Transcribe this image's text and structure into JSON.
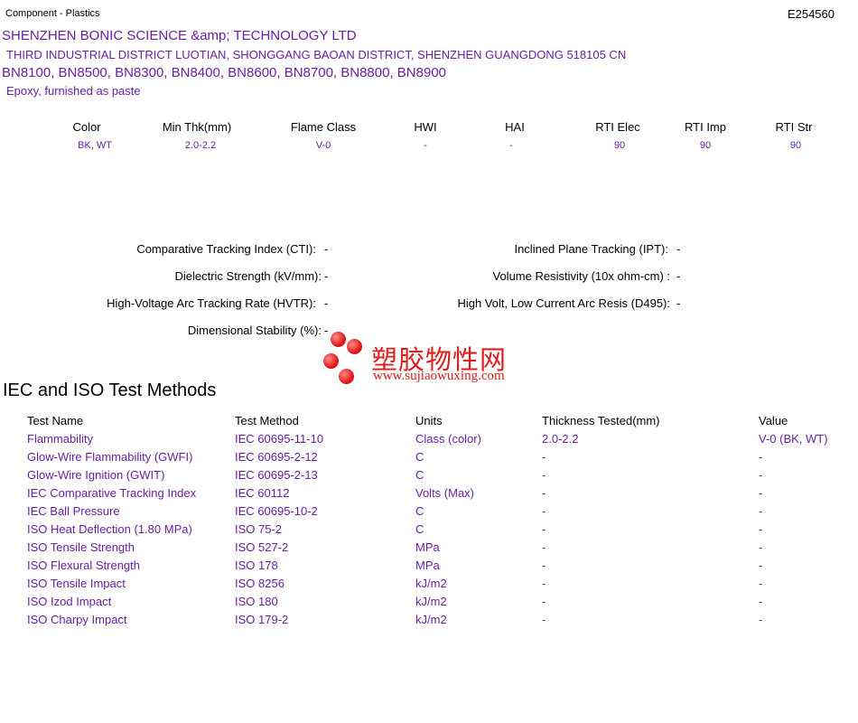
{
  "header": {
    "category": "Component - Plastics",
    "file_number": "E254560"
  },
  "company": {
    "name": "SHENZHEN BONIC SCIENCE &amp; TECHNOLOGY LTD",
    "address": "THIRD INDUSTRIAL DISTRICT LUOTIAN, SHONGGANG BAOAN DISTRICT, SHENZHEN  GUANGDONG  518105 CN",
    "grades": "BN8100, BN8500, BN8300, BN8400, BN8600, BN8700, BN8800, BN8900",
    "material": "Epoxy, furnished as paste"
  },
  "properties_table": {
    "headers": [
      "Color",
      "Min Thk(mm)",
      "Flame Class",
      "HWI",
      "HAI",
      "RTI Elec",
      "RTI Imp",
      "RTI Str"
    ],
    "values": [
      "BK, WT",
      "2.0-2.2",
      "V-0",
      "-",
      "-",
      "90",
      "90",
      "90"
    ]
  },
  "electrical": {
    "cti_label": "Comparative Tracking Index (CTI):",
    "cti_value": "-",
    "ds_label": "Dielectric Strength (kV/mm):",
    "ds_value": "-",
    "hvtr_label": "High-Voltage Arc Tracking Rate (HVTR):",
    "hvtr_value": "-",
    "dim_label": "Dimensional Stability (%):",
    "dim_value": "-",
    "ipt_label": "Inclined Plane Tracking (IPT):",
    "ipt_value": "-",
    "vr_label": "Volume Resistivity (10x ohm-cm) :",
    "vr_value": "-",
    "d495_label": "High Volt, Low Current Arc Resis (D495):",
    "d495_value": "-"
  },
  "watermark": {
    "text": "塑胶物性网",
    "url": "www.sujiaowuxing.com"
  },
  "iec": {
    "title": "IEC and ISO Test Methods",
    "headers": [
      "Test Name",
      "Test Method",
      "Units",
      "Thickness Tested(mm)",
      "Value"
    ],
    "rows": [
      [
        "Flammability",
        "IEC 60695-11-10",
        "Class (color)",
        "2.0-2.2",
        "V-0 (BK, WT)"
      ],
      [
        "Glow-Wire Flammability (GWFI)",
        "IEC 60695-2-12",
        "C",
        "-",
        "-"
      ],
      [
        "Glow-Wire Ignition (GWIT)",
        "IEC 60695-2-13",
        "C",
        "-",
        "-"
      ],
      [
        "IEC Comparative Tracking Index",
        "IEC 60112",
        "Volts (Max)",
        "-",
        "-"
      ],
      [
        "IEC Ball Pressure",
        "IEC 60695-10-2",
        "C",
        "-",
        "-"
      ],
      [
        "ISO Heat Deflection (1.80 MPa)",
        "ISO 75-2",
        "C",
        "-",
        "-"
      ],
      [
        "ISO Tensile Strength",
        "ISO 527-2",
        "MPa",
        "-",
        "-"
      ],
      [
        "ISO Flexural Strength",
        "ISO 178",
        "MPa",
        "-",
        "-"
      ],
      [
        "ISO Tensile Impact",
        "ISO 8256",
        "kJ/m2",
        "-",
        "-"
      ],
      [
        "ISO Izod Impact",
        "ISO 180",
        "kJ/m2",
        "-",
        "-"
      ],
      [
        "ISO Charpy Impact",
        "ISO 179-2",
        "kJ/m2",
        "-",
        "-"
      ]
    ]
  },
  "colors": {
    "accent": "#6a1fa5",
    "watermark": "#e21b1b"
  }
}
